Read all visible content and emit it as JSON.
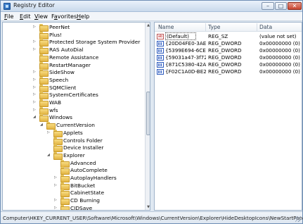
{
  "window": {
    "title": "Registry Editor",
    "controls": {
      "minimize": "–",
      "maximize": "□",
      "close": "✕"
    }
  },
  "menu": [
    "File",
    "Edit",
    "View",
    "Favorites",
    "Help"
  ],
  "menu_mnemonics": [
    "F",
    "E",
    "V",
    "a",
    "H"
  ],
  "tree": [
    {
      "label": "PeerNet",
      "depth": 0,
      "expander": "▷"
    },
    {
      "label": "Plus!",
      "depth": 0,
      "expander": ""
    },
    {
      "label": "Protected Storage System Provider",
      "depth": 0,
      "expander": "▷"
    },
    {
      "label": "RAS AutoDial",
      "depth": 0,
      "expander": "▷"
    },
    {
      "label": "Remote Assistance",
      "depth": 0,
      "expander": ""
    },
    {
      "label": "RestartManager",
      "depth": 0,
      "expander": ""
    },
    {
      "label": "SideShow",
      "depth": 0,
      "expander": "▷"
    },
    {
      "label": "Speech",
      "depth": 0,
      "expander": "▷"
    },
    {
      "label": "SQMClient",
      "depth": 0,
      "expander": "▷"
    },
    {
      "label": "SystemCertificates",
      "depth": 0,
      "expander": "▷"
    },
    {
      "label": "WAB",
      "depth": 0,
      "expander": "▷"
    },
    {
      "label": "wfs",
      "depth": 0,
      "expander": "▷"
    },
    {
      "label": "Windows",
      "depth": 0,
      "expander": "◢"
    },
    {
      "label": "CurrentVersion",
      "depth": 1,
      "expander": "◢"
    },
    {
      "label": "Applets",
      "depth": 2,
      "expander": "▷"
    },
    {
      "label": "Controls Folder",
      "depth": 2,
      "expander": ""
    },
    {
      "label": "Device Installer",
      "depth": 2,
      "expander": ""
    },
    {
      "label": "Explorer",
      "depth": 2,
      "expander": "◢"
    },
    {
      "label": "Advanced",
      "depth": 3,
      "expander": ""
    },
    {
      "label": "AutoComplete",
      "depth": 3,
      "expander": ""
    },
    {
      "label": "AutoplayHandlers",
      "depth": 3,
      "expander": "▷"
    },
    {
      "label": "BitBucket",
      "depth": 3,
      "expander": "▷"
    },
    {
      "label": "CabinetState",
      "depth": 3,
      "expander": ""
    },
    {
      "label": "CD Burning",
      "depth": 3,
      "expander": "▷"
    },
    {
      "label": "CIDSave",
      "depth": 3,
      "expander": "▷"
    }
  ],
  "list": {
    "columns": [
      "Name",
      "Type",
      "Data"
    ],
    "rows": [
      {
        "icon": "string-value-icon",
        "name": "(Default)",
        "type": "REG_SZ",
        "data": "(value not set)",
        "selected": true
      },
      {
        "icon": "dword-value-icon",
        "name": "{20D04FE0-3AEA...",
        "type": "REG_DWORD",
        "data": "0x00000000 (0)",
        "selected": false
      },
      {
        "icon": "dword-value-icon",
        "name": "{5399E694-6CE5...",
        "type": "REG_DWORD",
        "data": "0x00000000 (0)",
        "selected": false
      },
      {
        "icon": "dword-value-icon",
        "name": "{59031a47-3f72-...",
        "type": "REG_DWORD",
        "data": "0x00000000 (0)",
        "selected": false
      },
      {
        "icon": "dword-value-icon",
        "name": "{871C5380-42A0...",
        "type": "REG_DWORD",
        "data": "0x00000000 (0)",
        "selected": false
      },
      {
        "icon": "dword-value-icon",
        "name": "{F02C1A0D-BE2...",
        "type": "REG_DWORD",
        "data": "0x00000000 (0)",
        "selected": false
      }
    ]
  },
  "status": {
    "path": "Computer\\HKEY_CURRENT_USER\\Software\\Microsoft\\Windows\\CurrentVersion\\Explorer\\HideDesktopIcons\\NewStartPanel"
  }
}
